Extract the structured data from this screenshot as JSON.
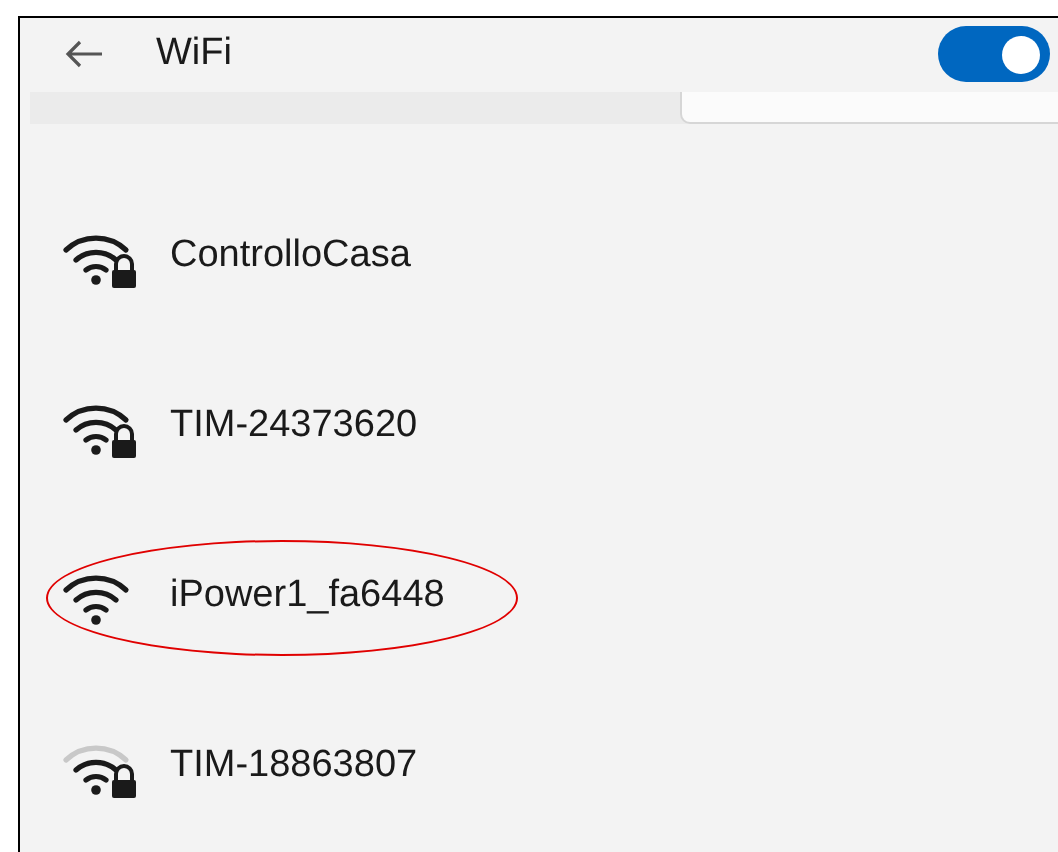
{
  "header": {
    "title": "WiFi",
    "wifi_on": true
  },
  "networks": [
    {
      "name": "ControlloCasa",
      "secured": true,
      "kind": "strong",
      "highlighted": false
    },
    {
      "name": "TIM-24373620",
      "secured": true,
      "kind": "strong",
      "highlighted": false
    },
    {
      "name": "iPower1_fa6448",
      "secured": false,
      "kind": "strong",
      "highlighted": true
    },
    {
      "name": "TIM-18863807",
      "secured": true,
      "kind": "weak",
      "highlighted": false
    }
  ]
}
